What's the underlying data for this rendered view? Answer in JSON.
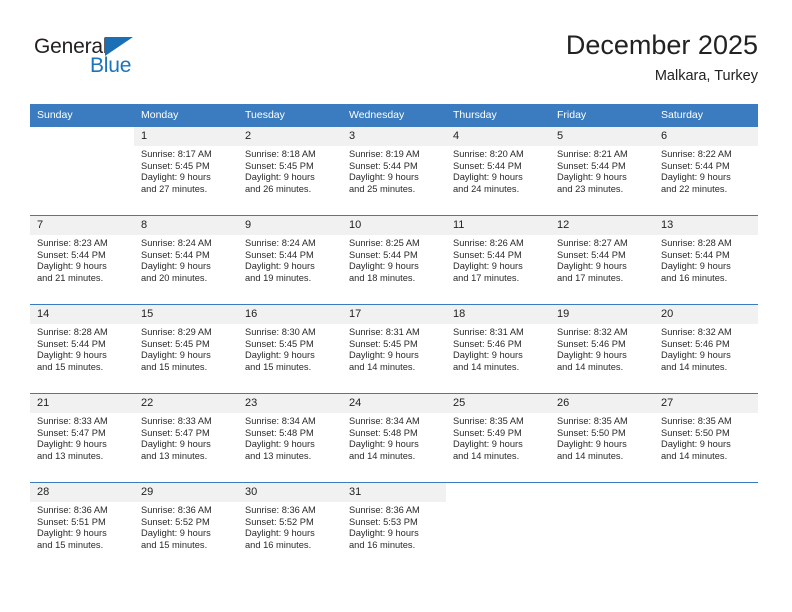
{
  "brand": {
    "name_top": "General",
    "name_bottom": "Blue",
    "triangle_icon": "blue-triangle-logo-mark"
  },
  "header": {
    "title": "December 2025",
    "subtitle": "Malkara, Turkey"
  },
  "colors": {
    "header_blue": "#3b7cc0",
    "brand_blue": "#1b75bc",
    "daynum_band": "#f1f1f1",
    "text": "#222222"
  },
  "weekdays": [
    "Sunday",
    "Monday",
    "Tuesday",
    "Wednesday",
    "Thursday",
    "Friday",
    "Saturday"
  ],
  "weeks": [
    [
      {
        "date": "",
        "sunrise": "",
        "sunset": "",
        "daylight_line1": "",
        "daylight_line2": ""
      },
      {
        "date": "1",
        "sunrise": "Sunrise: 8:17 AM",
        "sunset": "Sunset: 5:45 PM",
        "daylight_line1": "Daylight: 9 hours",
        "daylight_line2": "and 27 minutes."
      },
      {
        "date": "2",
        "sunrise": "Sunrise: 8:18 AM",
        "sunset": "Sunset: 5:45 PM",
        "daylight_line1": "Daylight: 9 hours",
        "daylight_line2": "and 26 minutes."
      },
      {
        "date": "3",
        "sunrise": "Sunrise: 8:19 AM",
        "sunset": "Sunset: 5:44 PM",
        "daylight_line1": "Daylight: 9 hours",
        "daylight_line2": "and 25 minutes."
      },
      {
        "date": "4",
        "sunrise": "Sunrise: 8:20 AM",
        "sunset": "Sunset: 5:44 PM",
        "daylight_line1": "Daylight: 9 hours",
        "daylight_line2": "and 24 minutes."
      },
      {
        "date": "5",
        "sunrise": "Sunrise: 8:21 AM",
        "sunset": "Sunset: 5:44 PM",
        "daylight_line1": "Daylight: 9 hours",
        "daylight_line2": "and 23 minutes."
      },
      {
        "date": "6",
        "sunrise": "Sunrise: 8:22 AM",
        "sunset": "Sunset: 5:44 PM",
        "daylight_line1": "Daylight: 9 hours",
        "daylight_line2": "and 22 minutes."
      }
    ],
    [
      {
        "date": "7",
        "sunrise": "Sunrise: 8:23 AM",
        "sunset": "Sunset: 5:44 PM",
        "daylight_line1": "Daylight: 9 hours",
        "daylight_line2": "and 21 minutes."
      },
      {
        "date": "8",
        "sunrise": "Sunrise: 8:24 AM",
        "sunset": "Sunset: 5:44 PM",
        "daylight_line1": "Daylight: 9 hours",
        "daylight_line2": "and 20 minutes."
      },
      {
        "date": "9",
        "sunrise": "Sunrise: 8:24 AM",
        "sunset": "Sunset: 5:44 PM",
        "daylight_line1": "Daylight: 9 hours",
        "daylight_line2": "and 19 minutes."
      },
      {
        "date": "10",
        "sunrise": "Sunrise: 8:25 AM",
        "sunset": "Sunset: 5:44 PM",
        "daylight_line1": "Daylight: 9 hours",
        "daylight_line2": "and 18 minutes."
      },
      {
        "date": "11",
        "sunrise": "Sunrise: 8:26 AM",
        "sunset": "Sunset: 5:44 PM",
        "daylight_line1": "Daylight: 9 hours",
        "daylight_line2": "and 17 minutes."
      },
      {
        "date": "12",
        "sunrise": "Sunrise: 8:27 AM",
        "sunset": "Sunset: 5:44 PM",
        "daylight_line1": "Daylight: 9 hours",
        "daylight_line2": "and 17 minutes."
      },
      {
        "date": "13",
        "sunrise": "Sunrise: 8:28 AM",
        "sunset": "Sunset: 5:44 PM",
        "daylight_line1": "Daylight: 9 hours",
        "daylight_line2": "and 16 minutes."
      }
    ],
    [
      {
        "date": "14",
        "sunrise": "Sunrise: 8:28 AM",
        "sunset": "Sunset: 5:44 PM",
        "daylight_line1": "Daylight: 9 hours",
        "daylight_line2": "and 15 minutes."
      },
      {
        "date": "15",
        "sunrise": "Sunrise: 8:29 AM",
        "sunset": "Sunset: 5:45 PM",
        "daylight_line1": "Daylight: 9 hours",
        "daylight_line2": "and 15 minutes."
      },
      {
        "date": "16",
        "sunrise": "Sunrise: 8:30 AM",
        "sunset": "Sunset: 5:45 PM",
        "daylight_line1": "Daylight: 9 hours",
        "daylight_line2": "and 15 minutes."
      },
      {
        "date": "17",
        "sunrise": "Sunrise: 8:31 AM",
        "sunset": "Sunset: 5:45 PM",
        "daylight_line1": "Daylight: 9 hours",
        "daylight_line2": "and 14 minutes."
      },
      {
        "date": "18",
        "sunrise": "Sunrise: 8:31 AM",
        "sunset": "Sunset: 5:46 PM",
        "daylight_line1": "Daylight: 9 hours",
        "daylight_line2": "and 14 minutes."
      },
      {
        "date": "19",
        "sunrise": "Sunrise: 8:32 AM",
        "sunset": "Sunset: 5:46 PM",
        "daylight_line1": "Daylight: 9 hours",
        "daylight_line2": "and 14 minutes."
      },
      {
        "date": "20",
        "sunrise": "Sunrise: 8:32 AM",
        "sunset": "Sunset: 5:46 PM",
        "daylight_line1": "Daylight: 9 hours",
        "daylight_line2": "and 14 minutes."
      }
    ],
    [
      {
        "date": "21",
        "sunrise": "Sunrise: 8:33 AM",
        "sunset": "Sunset: 5:47 PM",
        "daylight_line1": "Daylight: 9 hours",
        "daylight_line2": "and 13 minutes."
      },
      {
        "date": "22",
        "sunrise": "Sunrise: 8:33 AM",
        "sunset": "Sunset: 5:47 PM",
        "daylight_line1": "Daylight: 9 hours",
        "daylight_line2": "and 13 minutes."
      },
      {
        "date": "23",
        "sunrise": "Sunrise: 8:34 AM",
        "sunset": "Sunset: 5:48 PM",
        "daylight_line1": "Daylight: 9 hours",
        "daylight_line2": "and 13 minutes."
      },
      {
        "date": "24",
        "sunrise": "Sunrise: 8:34 AM",
        "sunset": "Sunset: 5:48 PM",
        "daylight_line1": "Daylight: 9 hours",
        "daylight_line2": "and 14 minutes."
      },
      {
        "date": "25",
        "sunrise": "Sunrise: 8:35 AM",
        "sunset": "Sunset: 5:49 PM",
        "daylight_line1": "Daylight: 9 hours",
        "daylight_line2": "and 14 minutes."
      },
      {
        "date": "26",
        "sunrise": "Sunrise: 8:35 AM",
        "sunset": "Sunset: 5:50 PM",
        "daylight_line1": "Daylight: 9 hours",
        "daylight_line2": "and 14 minutes."
      },
      {
        "date": "27",
        "sunrise": "Sunrise: 8:35 AM",
        "sunset": "Sunset: 5:50 PM",
        "daylight_line1": "Daylight: 9 hours",
        "daylight_line2": "and 14 minutes."
      }
    ],
    [
      {
        "date": "28",
        "sunrise": "Sunrise: 8:36 AM",
        "sunset": "Sunset: 5:51 PM",
        "daylight_line1": "Daylight: 9 hours",
        "daylight_line2": "and 15 minutes."
      },
      {
        "date": "29",
        "sunrise": "Sunrise: 8:36 AM",
        "sunset": "Sunset: 5:52 PM",
        "daylight_line1": "Daylight: 9 hours",
        "daylight_line2": "and 15 minutes."
      },
      {
        "date": "30",
        "sunrise": "Sunrise: 8:36 AM",
        "sunset": "Sunset: 5:52 PM",
        "daylight_line1": "Daylight: 9 hours",
        "daylight_line2": "and 16 minutes."
      },
      {
        "date": "31",
        "sunrise": "Sunrise: 8:36 AM",
        "sunset": "Sunset: 5:53 PM",
        "daylight_line1": "Daylight: 9 hours",
        "daylight_line2": "and 16 minutes."
      },
      {
        "date": "",
        "sunrise": "",
        "sunset": "",
        "daylight_line1": "",
        "daylight_line2": ""
      },
      {
        "date": "",
        "sunrise": "",
        "sunset": "",
        "daylight_line1": "",
        "daylight_line2": ""
      },
      {
        "date": "",
        "sunrise": "",
        "sunset": "",
        "daylight_line1": "",
        "daylight_line2": ""
      }
    ]
  ]
}
